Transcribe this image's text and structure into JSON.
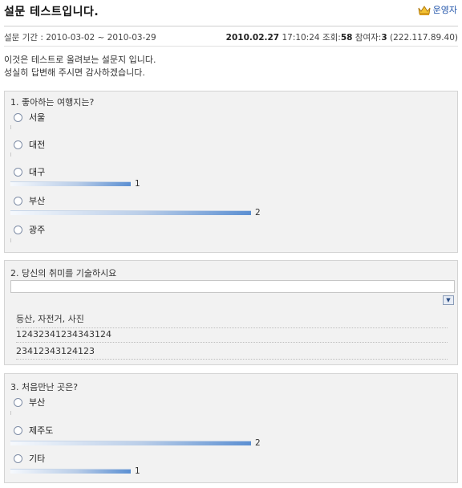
{
  "survey": {
    "title": "설문 테스트입니다.",
    "author": "운영자",
    "period": "설문 기간 : 2010-03-02 ~ 2010-03-29",
    "date": "2010.02.27",
    "time": "17:10:24",
    "views_label": "조회:",
    "views": "58",
    "participants_label": "참여자:",
    "participants": "3",
    "ip": "(222.117.89.40)",
    "description": [
      "이것은 테스트로 올려보는 설문지 입니다.",
      "성실히 답변해 주시면 감사하겠습니다."
    ]
  },
  "questions": [
    {
      "label": "1. 좋아하는 여행지는?",
      "options": [
        {
          "label": "서울",
          "count": 0,
          "count_label": ""
        },
        {
          "label": "대전",
          "count": 0,
          "count_label": ""
        },
        {
          "label": "대구",
          "count": 1,
          "count_label": "1"
        },
        {
          "label": "부산",
          "count": 2,
          "count_label": "2"
        },
        {
          "label": "광주",
          "count": 0,
          "count_label": ""
        }
      ]
    },
    {
      "label": "2. 당신의 취미를 기술하시요",
      "input_value": "",
      "answers": [
        "등산, 자전거, 사진",
        "12432341234343124",
        "23412343124123"
      ]
    },
    {
      "label": "3. 처음만난 곳은?",
      "options": [
        {
          "label": "부산",
          "count": 0,
          "count_label": ""
        },
        {
          "label": "제주도",
          "count": 2,
          "count_label": "2"
        },
        {
          "label": "기타",
          "count": 1,
          "count_label": "1"
        }
      ]
    }
  ],
  "icons": {
    "admin": "crown-icon",
    "dropdown": "chevron-down-icon",
    "option": "radio-icon"
  },
  "colors": {
    "bar": "#5b8fd2",
    "author": "#2255aa",
    "box_bg": "#f2f2f2"
  }
}
